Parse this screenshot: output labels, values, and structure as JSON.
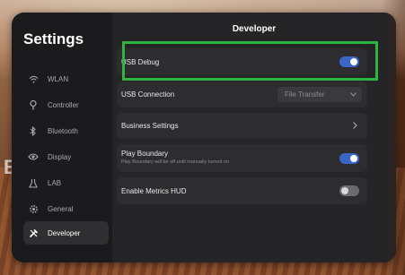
{
  "sidebar": {
    "title": "Settings",
    "items": [
      {
        "label": "WLAN",
        "icon": "wifi-icon"
      },
      {
        "label": "Controller",
        "icon": "controller-icon"
      },
      {
        "label": "Bluetooth",
        "icon": "bluetooth-icon"
      },
      {
        "label": "Display",
        "icon": "eye-icon"
      },
      {
        "label": "LAB",
        "icon": "flask-icon"
      },
      {
        "label": "General",
        "icon": "gear-icon"
      },
      {
        "label": "Developer",
        "icon": "tools-icon",
        "active": true
      }
    ]
  },
  "main": {
    "title": "Developer",
    "rows": {
      "usb_debug": {
        "label": "USB Debug",
        "toggle": "on"
      },
      "usb_connection": {
        "label": "USB Connection",
        "select_value": "File Transfer"
      },
      "business_settings": {
        "label": "Business Settings"
      },
      "play_boundary": {
        "label": "Play Boundary",
        "description": "Play Boundary will be off until manually turned on",
        "toggle": "on"
      },
      "metrics_hud": {
        "label": "Enable Metrics HUD",
        "toggle": "off"
      }
    }
  },
  "colors": {
    "accent": "#3a66c8",
    "highlight": "#2fb341"
  }
}
